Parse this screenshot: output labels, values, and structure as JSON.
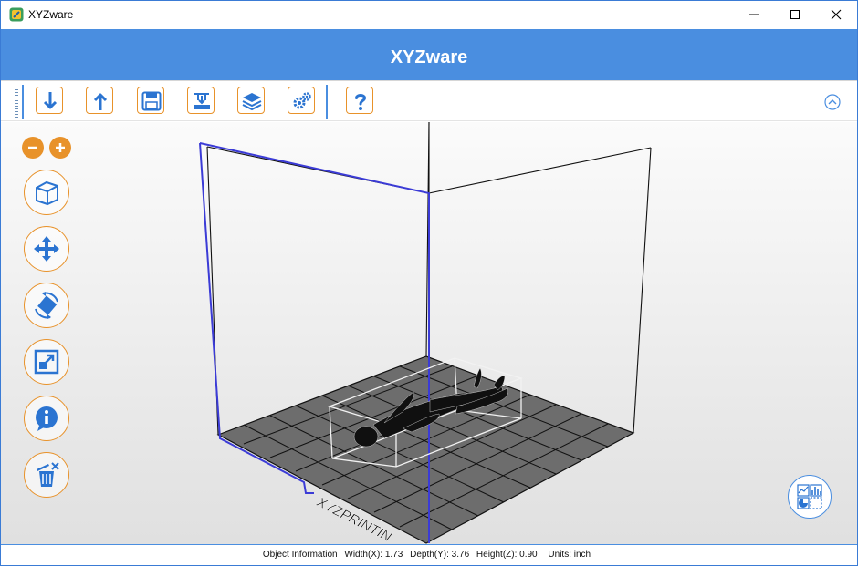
{
  "window": {
    "title": "XYZware",
    "controls": {
      "minimize": "minimize-icon",
      "maximize": "maximize-icon",
      "close": "close-icon"
    }
  },
  "header": {
    "title": "XYZware"
  },
  "toolbar": {
    "items": [
      {
        "name": "import",
        "icon": "import-arrow-down-icon"
      },
      {
        "name": "export",
        "icon": "export-arrow-up-icon"
      },
      {
        "name": "save",
        "icon": "save-floppy-icon"
      },
      {
        "name": "print",
        "icon": "print-icon"
      },
      {
        "name": "layers",
        "icon": "layers-icon"
      },
      {
        "name": "settings",
        "icon": "gears-icon"
      },
      {
        "name": "help",
        "icon": "question-icon"
      }
    ],
    "collapse": "chevron-up-icon"
  },
  "viewport": {
    "zoom": [
      "zoom-out-icon",
      "zoom-in-icon"
    ],
    "tools": [
      "view-cube-icon",
      "move-icon",
      "rotate-icon",
      "scale-icon",
      "info-icon",
      "delete-icon"
    ],
    "bed_label": "XYZPRINTIN",
    "stats_button": "statistics-icon"
  },
  "colors": {
    "accent": "#e8922a",
    "header": "#4a8ee0",
    "axis": "#3b3bd6"
  },
  "status": {
    "label": "Object Information",
    "width": "Width(X): 1.73",
    "depth": "Depth(Y): 3.76",
    "height": "Height(Z): 0.90",
    "units": "Units: inch"
  }
}
